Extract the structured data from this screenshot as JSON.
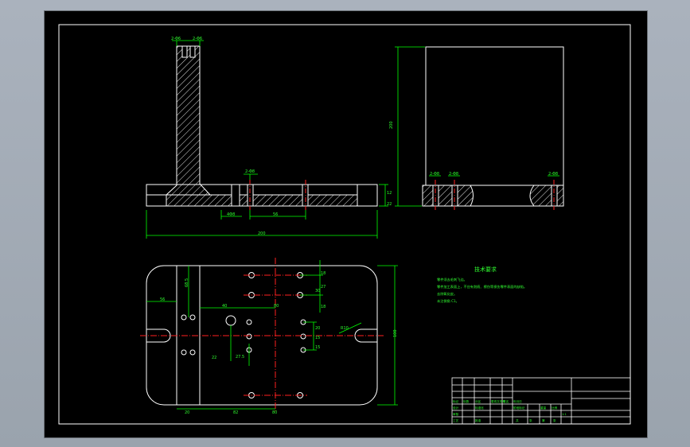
{
  "view": {
    "background": "#000000",
    "colors": {
      "outline": "#ffffff",
      "dimension": "#00ff00",
      "centerline": "#ff2020",
      "hatch": "#ffffff",
      "text": "#30ff30",
      "frame_bg": "#aab2bd"
    }
  },
  "front_view": {
    "top_dims": [
      "2-Φ6",
      "2-Φ6"
    ],
    "hole_labels": [
      "2-Φ8"
    ],
    "dims": {
      "base_height": "12",
      "step": "22",
      "overall_width": "200",
      "bolt_spacing": "56",
      "left_offset": "4Φ8"
    }
  },
  "side_view": {
    "height_dim": "200",
    "hole_labels": [
      "2-Φ8",
      "2-Φ8",
      "2-Φ8"
    ]
  },
  "top_view": {
    "dims_right": [
      "18",
      "27",
      "18"
    ],
    "dims_left": [
      "68.5",
      "56"
    ],
    "dims_mid": [
      "40",
      "80",
      "22",
      "27.5"
    ],
    "dims_vert": [
      "20",
      "15",
      "15",
      "30"
    ],
    "overall_height": "100",
    "radius": "R10",
    "bottom_dims": [
      "20",
      "82",
      "80"
    ]
  },
  "tech_requirements": {
    "title": "技术要求",
    "lines": [
      "零件须去毛刺飞边。",
      "零件加工表面上，不应有划痕、擦伤等损伤零件表面的缺陷。",
      "去除氧化皮。",
      "未注倒角 C1。"
    ]
  },
  "title_block": {
    "cells": [
      "标记",
      "处数",
      "分区",
      "更改文件号",
      "签名",
      "年月日",
      "设计",
      "标准化",
      "阶段标记",
      "重量",
      "比例",
      "审核",
      "工艺",
      "批准",
      "共",
      "张",
      "第",
      "张",
      "1:1"
    ]
  }
}
